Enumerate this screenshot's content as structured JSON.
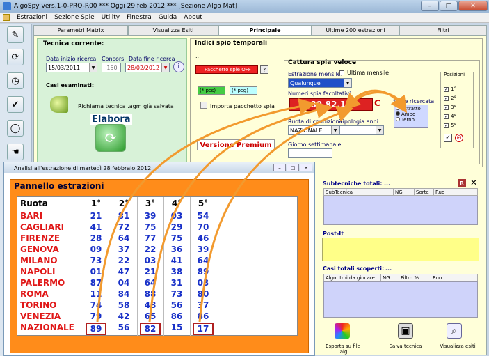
{
  "window": {
    "title": "AlgoSpy vers.1-0-PRO-R00  ***  Oggi 29 feb 2012  ***  [Sezione Algo Mat]",
    "minimize": "–",
    "maximize": "□",
    "close": "✕"
  },
  "menu": [
    "Estrazioni",
    "Sezione Spie",
    "Utility",
    "Finestra",
    "Guida",
    "About"
  ],
  "tabs": [
    {
      "label": "Parametri Matrix",
      "active": false
    },
    {
      "label": "Visualizza Esiti",
      "active": false
    },
    {
      "label": "Principale",
      "active": true
    },
    {
      "label": "Ultime 200 estrazioni",
      "active": false
    },
    {
      "label": "Filtri",
      "active": false
    }
  ],
  "tecnica": {
    "title": "Tecnica corrente:",
    "data_inizio_label": "Data inizio ricerca",
    "concorsi_label": "Concorsi",
    "data_fine_label": "Data fine ricerca",
    "data_inizio": "15/03/2011",
    "concorsi": "150",
    "data_fine": "28/02/2012",
    "casi_label": "Casi esaminati:",
    "richiama_label": "Richiama tecnica .agm già salvata",
    "elabora_label": "Elabora"
  },
  "indici": {
    "title": "Indici spio temporali",
    "ellipsis": "...",
    "pacchetto_label": "Pacchetto spie OFF",
    "help_label": "?",
    "pcs_label": "(*.pcs)",
    "pcg_label": "(*.pcg)",
    "importa_label": "Importa pacchetto spia",
    "versione_label": "Versione Premium"
  },
  "cattura": {
    "title": "Cattura spia veloce",
    "estrazione_label": "Estrazione mensile:",
    "ultima_label": "Ultima mensile",
    "estrazione_value": "Qualunque",
    "numeri_label": "Numeri spia facoltativi",
    "spia_value": "89.82.17",
    "c_label": "C",
    "ruota_label": "Ruota di condizione",
    "ruota_value": "NAZIONALE",
    "tipologia_label": "Tipologia anni",
    "giorno_label": "Giorno settimanale",
    "sorte_title": "Sorte ricercata",
    "sorte_options": [
      "Estratto",
      "Ambo",
      "Terno"
    ],
    "posizioni_title": "Posizioni",
    "posizioni": [
      "1°",
      "2°",
      "3°",
      "4°",
      "5°"
    ]
  },
  "analisi": {
    "title": "Analisi all'estrazione di martedì 28 febbraio 2012",
    "pannello_title": "Pannello estrazioni",
    "headers": [
      "Ruota",
      "1°",
      "2°",
      "3°",
      "4°",
      "5°"
    ],
    "rows": [
      {
        "ruota": "BARI",
        "nums": [
          "21",
          "81",
          "39",
          "03",
          "54"
        ]
      },
      {
        "ruota": "CAGLIARI",
        "nums": [
          "41",
          "72",
          "75",
          "29",
          "70"
        ]
      },
      {
        "ruota": "FIRENZE",
        "nums": [
          "28",
          "64",
          "77",
          "75",
          "46"
        ]
      },
      {
        "ruota": "GENOVA",
        "nums": [
          "09",
          "37",
          "22",
          "36",
          "39"
        ]
      },
      {
        "ruota": "MILANO",
        "nums": [
          "73",
          "22",
          "03",
          "41",
          "64"
        ]
      },
      {
        "ruota": "NAPOLI",
        "nums": [
          "01",
          "47",
          "21",
          "38",
          "89"
        ]
      },
      {
        "ruota": "PALERMO",
        "nums": [
          "87",
          "04",
          "64",
          "31",
          "03"
        ]
      },
      {
        "ruota": "ROMA",
        "nums": [
          "11",
          "84",
          "88",
          "73",
          "80"
        ]
      },
      {
        "ruota": "TORINO",
        "nums": [
          "74",
          "58",
          "48",
          "56",
          "37"
        ]
      },
      {
        "ruota": "VENEZIA",
        "nums": [
          "79",
          "42",
          "65",
          "86",
          "86"
        ]
      },
      {
        "ruota": "NAZIONALE",
        "nums": [
          "89",
          "56",
          "82",
          "15",
          "17"
        ]
      }
    ]
  },
  "right": {
    "subtecniche_label": "Subtecniche totali:",
    "subtecniche_value": "...",
    "sub_headers": [
      "SubTecnica",
      "NG",
      "Sorte",
      "Ruo"
    ],
    "postit_label": "Post-It",
    "casi_label": "Casi totali scoperti:",
    "casi_value": "...",
    "casi_headers": [
      "Algoritmi da giocare",
      "NG",
      "Filtro %",
      "Ruo"
    ],
    "esporta_label": "Esporta su file .alg",
    "salva_label": "Salva tecnica",
    "visualizza_label": "Visualizza esiti"
  }
}
